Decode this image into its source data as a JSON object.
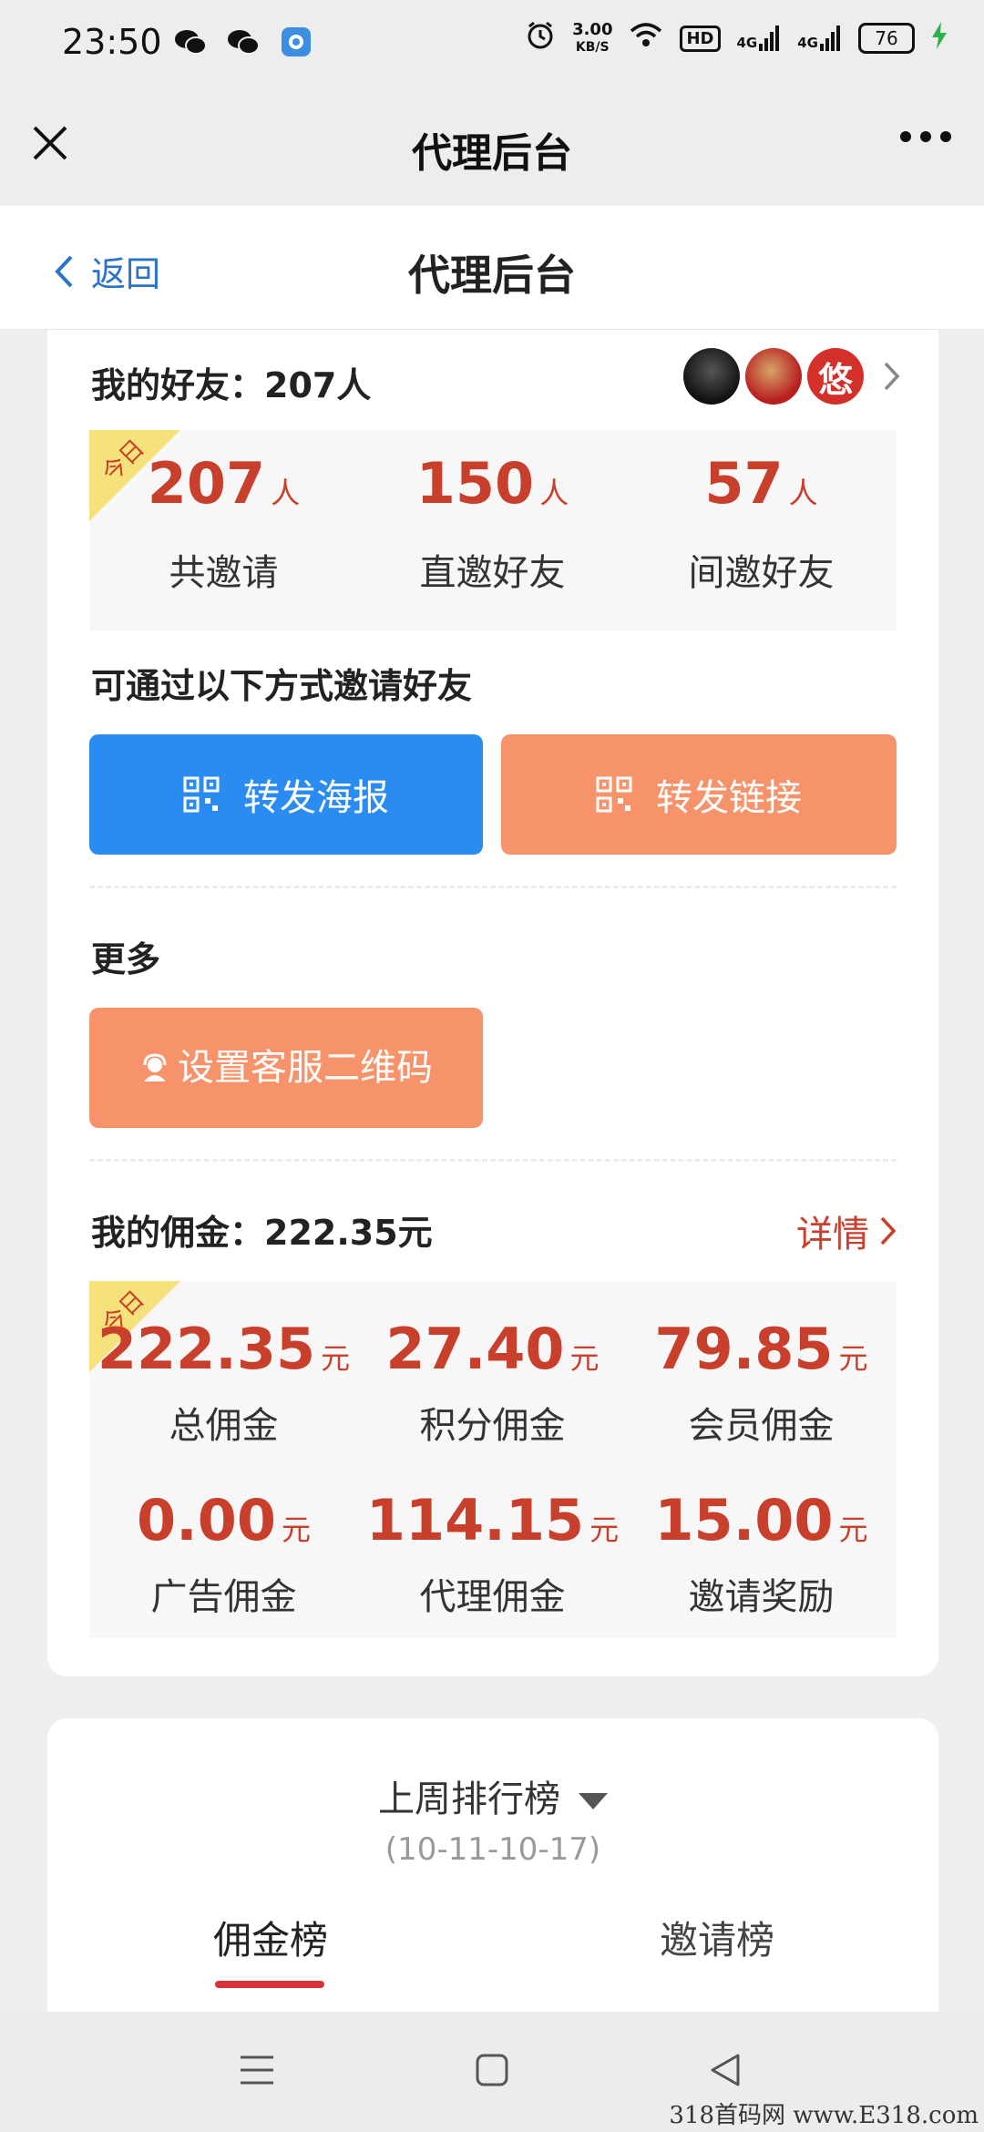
{
  "status_bar": {
    "time": "23:50",
    "net_speed_value": "3.00",
    "net_speed_unit": "KB/S",
    "hd_label": "HD",
    "signal1_label": "4G",
    "signal2_label": "4G",
    "battery": "76"
  },
  "wechat_bar": {
    "title": "代理后台"
  },
  "page_header": {
    "back_label": "返回",
    "title": "代理后台"
  },
  "friends": {
    "title": "我的好友：207人",
    "avatar3_text": "悠",
    "stats": [
      {
        "num": "207",
        "unit": "人",
        "label": "共邀请"
      },
      {
        "num": "150",
        "unit": "人",
        "label": "直邀好友"
      },
      {
        "num": "57",
        "unit": "人",
        "label": "间邀好友"
      }
    ]
  },
  "ribbon_text": "今日",
  "invite": {
    "title": "可通过以下方式邀请好友",
    "poster_button": "转发海报",
    "link_button": "转发链接"
  },
  "more": {
    "title": "更多",
    "service_button": "设置客服二维码"
  },
  "commission": {
    "title": "我的佣金：222.35元",
    "detail_label": "详情",
    "stats": [
      {
        "num": "222.35",
        "unit": "元",
        "label": "总佣金"
      },
      {
        "num": "27.40",
        "unit": "元",
        "label": "积分佣金"
      },
      {
        "num": "79.85",
        "unit": "元",
        "label": "会员佣金"
      },
      {
        "num": "0.00",
        "unit": "元",
        "label": "广告佣金"
      },
      {
        "num": "114.15",
        "unit": "元",
        "label": "代理佣金"
      },
      {
        "num": "15.00",
        "unit": "元",
        "label": "邀请奖励"
      }
    ]
  },
  "ranking": {
    "title": "上周排行榜",
    "date_range": "(10-11-10-17)",
    "tab_active": "佣金榜",
    "tab_other": "邀请榜"
  },
  "watermark": "318首码网 www.E318.com",
  "colors": {
    "accent_red": "#c8402c",
    "blue_button": "#2a8cf0",
    "orange_button": "#f7936a",
    "link_blue": "#2a73c8",
    "ribbon": "#f6e27a"
  }
}
